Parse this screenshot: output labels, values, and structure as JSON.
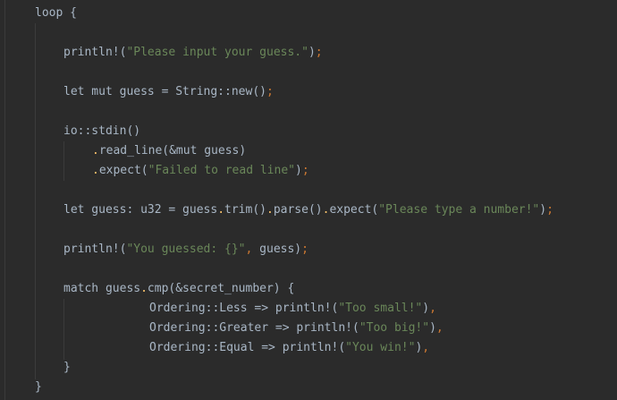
{
  "editor": {
    "language": "rust",
    "lines": [
      {
        "indent": 0,
        "tokens": [
          [
            "plain",
            "loop {"
          ]
        ]
      },
      {
        "indent": 0,
        "tokens": []
      },
      {
        "indent": 1,
        "tokens": [
          [
            "plain",
            "println!("
          ],
          [
            "str",
            "\"Please input your guess.\""
          ],
          [
            "plain",
            ")"
          ],
          [
            "semi",
            ";"
          ]
        ]
      },
      {
        "indent": 0,
        "tokens": []
      },
      {
        "indent": 1,
        "tokens": [
          [
            "plain",
            "let mut guess = String::new()"
          ],
          [
            "semi",
            ";"
          ]
        ]
      },
      {
        "indent": 0,
        "tokens": []
      },
      {
        "indent": 1,
        "tokens": [
          [
            "plain",
            "io::stdin()"
          ]
        ]
      },
      {
        "indent": 2,
        "tokens": [
          [
            "chain",
            "."
          ],
          [
            "plain",
            "read_line(&mut guess)"
          ]
        ]
      },
      {
        "indent": 2,
        "tokens": [
          [
            "chain",
            "."
          ],
          [
            "plain",
            "expect("
          ],
          [
            "str",
            "\"Failed to read line\""
          ],
          [
            "plain",
            ")"
          ],
          [
            "semi",
            ";"
          ]
        ]
      },
      {
        "indent": 0,
        "tokens": []
      },
      {
        "indent": 1,
        "tokens": [
          [
            "plain",
            "let guess: u32 = guess"
          ],
          [
            "chain",
            "."
          ],
          [
            "plain",
            "trim()"
          ],
          [
            "chain",
            "."
          ],
          [
            "plain",
            "parse()"
          ],
          [
            "chain",
            "."
          ],
          [
            "plain",
            "expect("
          ],
          [
            "str",
            "\"Please type a number!\""
          ],
          [
            "plain",
            ")"
          ],
          [
            "semi",
            ";"
          ]
        ]
      },
      {
        "indent": 0,
        "tokens": []
      },
      {
        "indent": 1,
        "tokens": [
          [
            "plain",
            "println!("
          ],
          [
            "str",
            "\"You guessed: {}\""
          ],
          [
            "semi",
            ","
          ],
          [
            "plain",
            " guess)"
          ],
          [
            "semi",
            ";"
          ]
        ]
      },
      {
        "indent": 0,
        "tokens": []
      },
      {
        "indent": 1,
        "tokens": [
          [
            "plain",
            "match guess"
          ],
          [
            "chain",
            "."
          ],
          [
            "plain",
            "cmp(&secret_number) {"
          ]
        ]
      },
      {
        "indent": 4,
        "tokens": [
          [
            "plain",
            "Ordering::Less => println!("
          ],
          [
            "str",
            "\"Too small!\""
          ],
          [
            "plain",
            ")"
          ],
          [
            "semi",
            ","
          ]
        ]
      },
      {
        "indent": 4,
        "tokens": [
          [
            "plain",
            "Ordering::Greater => println!("
          ],
          [
            "str",
            "\"Too big!\""
          ],
          [
            "plain",
            ")"
          ],
          [
            "semi",
            ","
          ]
        ]
      },
      {
        "indent": 4,
        "tokens": [
          [
            "plain",
            "Ordering::Equal => println!("
          ],
          [
            "str",
            "\"You win!\""
          ],
          [
            "plain",
            ")"
          ],
          [
            "semi",
            ","
          ]
        ]
      },
      {
        "indent": 1,
        "tokens": [
          [
            "plain",
            "}"
          ]
        ]
      },
      {
        "indent": 0,
        "tokens": [
          [
            "plain",
            "}"
          ]
        ]
      }
    ]
  }
}
